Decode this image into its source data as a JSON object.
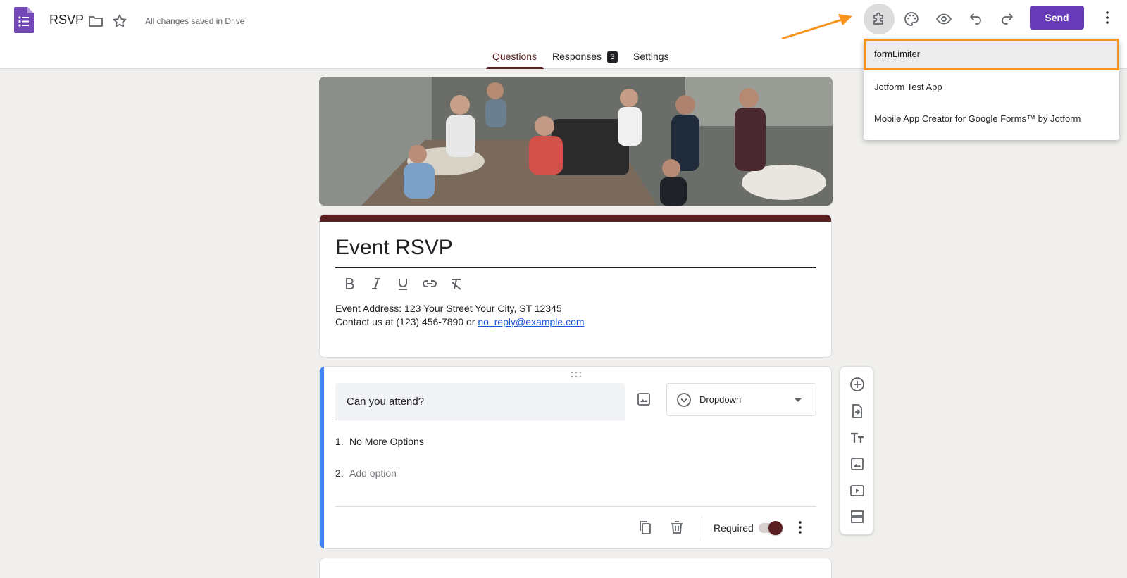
{
  "header": {
    "title": "RSVP",
    "save_status": "All changes saved in Drive",
    "send_label": "Send",
    "icons": [
      "forms-logo",
      "folder-icon",
      "star-icon",
      "addons-puzzle-icon",
      "palette-icon",
      "preview-eye-icon",
      "undo-icon",
      "redo-icon",
      "more-vert-icon"
    ]
  },
  "tabs": [
    {
      "label": "Questions",
      "active": true
    },
    {
      "label": "Responses",
      "badge": "3"
    },
    {
      "label": "Settings"
    }
  ],
  "form": {
    "title": "Event RSVP",
    "description_line1": "Event Address: 123 Your Street Your City, ST 12345",
    "description_line2_prefix": "Contact us at (123) 456-7890 or ",
    "email": "no_reply@example.com",
    "format_tools": [
      "bold-icon",
      "italic-icon",
      "underline-icon",
      "link-icon",
      "clear-format-icon"
    ]
  },
  "question": {
    "title": "Can you attend?",
    "type": "Dropdown",
    "options": [
      {
        "num": "1.",
        "label": "No More Options"
      },
      {
        "num": "2.",
        "label": "Add option"
      }
    ],
    "required_label": "Required",
    "required": true
  },
  "addons_menu": {
    "items": [
      {
        "label": "formLimiter",
        "highlighted": true
      },
      {
        "label": "Jotform Test App"
      },
      {
        "label": "Mobile App Creator for Google Forms™ by Jotform"
      }
    ]
  },
  "floating_toolbar": [
    "add-question-icon",
    "import-questions-icon",
    "add-title-icon",
    "add-image-icon",
    "add-video-icon",
    "add-section-icon"
  ],
  "colors": {
    "theme": "#5a1f21",
    "send": "#673ab7",
    "question_accent": "#4285f4",
    "annotation": "#f7931e"
  }
}
